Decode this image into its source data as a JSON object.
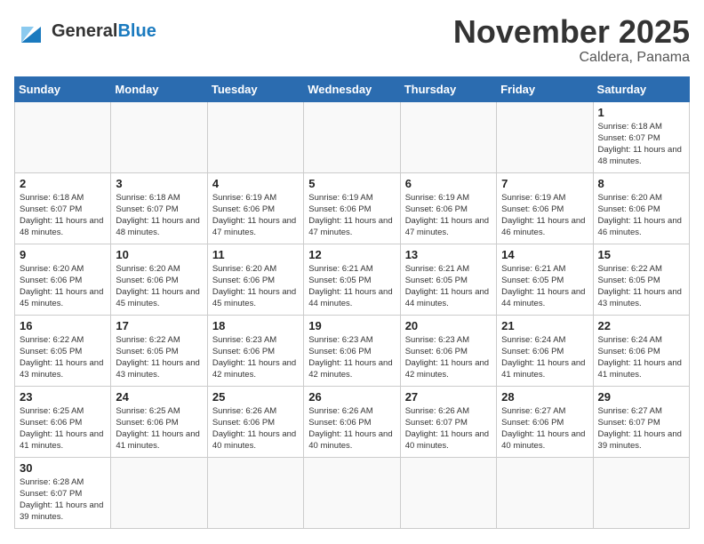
{
  "header": {
    "logo_general": "General",
    "logo_blue": "Blue",
    "month": "November 2025",
    "location": "Caldera, Panama"
  },
  "weekdays": [
    "Sunday",
    "Monday",
    "Tuesday",
    "Wednesday",
    "Thursday",
    "Friday",
    "Saturday"
  ],
  "weeks": [
    [
      {
        "day": "",
        "info": ""
      },
      {
        "day": "",
        "info": ""
      },
      {
        "day": "",
        "info": ""
      },
      {
        "day": "",
        "info": ""
      },
      {
        "day": "",
        "info": ""
      },
      {
        "day": "",
        "info": ""
      },
      {
        "day": "1",
        "info": "Sunrise: 6:18 AM\nSunset: 6:07 PM\nDaylight: 11 hours\nand 48 minutes."
      }
    ],
    [
      {
        "day": "2",
        "info": "Sunrise: 6:18 AM\nSunset: 6:07 PM\nDaylight: 11 hours\nand 48 minutes."
      },
      {
        "day": "3",
        "info": "Sunrise: 6:18 AM\nSunset: 6:07 PM\nDaylight: 11 hours\nand 48 minutes."
      },
      {
        "day": "4",
        "info": "Sunrise: 6:19 AM\nSunset: 6:06 PM\nDaylight: 11 hours\nand 47 minutes."
      },
      {
        "day": "5",
        "info": "Sunrise: 6:19 AM\nSunset: 6:06 PM\nDaylight: 11 hours\nand 47 minutes."
      },
      {
        "day": "6",
        "info": "Sunrise: 6:19 AM\nSunset: 6:06 PM\nDaylight: 11 hours\nand 47 minutes."
      },
      {
        "day": "7",
        "info": "Sunrise: 6:19 AM\nSunset: 6:06 PM\nDaylight: 11 hours\nand 46 minutes."
      },
      {
        "day": "8",
        "info": "Sunrise: 6:20 AM\nSunset: 6:06 PM\nDaylight: 11 hours\nand 46 minutes."
      }
    ],
    [
      {
        "day": "9",
        "info": "Sunrise: 6:20 AM\nSunset: 6:06 PM\nDaylight: 11 hours\nand 45 minutes."
      },
      {
        "day": "10",
        "info": "Sunrise: 6:20 AM\nSunset: 6:06 PM\nDaylight: 11 hours\nand 45 minutes."
      },
      {
        "day": "11",
        "info": "Sunrise: 6:20 AM\nSunset: 6:06 PM\nDaylight: 11 hours\nand 45 minutes."
      },
      {
        "day": "12",
        "info": "Sunrise: 6:21 AM\nSunset: 6:05 PM\nDaylight: 11 hours\nand 44 minutes."
      },
      {
        "day": "13",
        "info": "Sunrise: 6:21 AM\nSunset: 6:05 PM\nDaylight: 11 hours\nand 44 minutes."
      },
      {
        "day": "14",
        "info": "Sunrise: 6:21 AM\nSunset: 6:05 PM\nDaylight: 11 hours\nand 44 minutes."
      },
      {
        "day": "15",
        "info": "Sunrise: 6:22 AM\nSunset: 6:05 PM\nDaylight: 11 hours\nand 43 minutes."
      }
    ],
    [
      {
        "day": "16",
        "info": "Sunrise: 6:22 AM\nSunset: 6:05 PM\nDaylight: 11 hours\nand 43 minutes."
      },
      {
        "day": "17",
        "info": "Sunrise: 6:22 AM\nSunset: 6:05 PM\nDaylight: 11 hours\nand 43 minutes."
      },
      {
        "day": "18",
        "info": "Sunrise: 6:23 AM\nSunset: 6:06 PM\nDaylight: 11 hours\nand 42 minutes."
      },
      {
        "day": "19",
        "info": "Sunrise: 6:23 AM\nSunset: 6:06 PM\nDaylight: 11 hours\nand 42 minutes."
      },
      {
        "day": "20",
        "info": "Sunrise: 6:23 AM\nSunset: 6:06 PM\nDaylight: 11 hours\nand 42 minutes."
      },
      {
        "day": "21",
        "info": "Sunrise: 6:24 AM\nSunset: 6:06 PM\nDaylight: 11 hours\nand 41 minutes."
      },
      {
        "day": "22",
        "info": "Sunrise: 6:24 AM\nSunset: 6:06 PM\nDaylight: 11 hours\nand 41 minutes."
      }
    ],
    [
      {
        "day": "23",
        "info": "Sunrise: 6:25 AM\nSunset: 6:06 PM\nDaylight: 11 hours\nand 41 minutes."
      },
      {
        "day": "24",
        "info": "Sunrise: 6:25 AM\nSunset: 6:06 PM\nDaylight: 11 hours\nand 41 minutes."
      },
      {
        "day": "25",
        "info": "Sunrise: 6:26 AM\nSunset: 6:06 PM\nDaylight: 11 hours\nand 40 minutes."
      },
      {
        "day": "26",
        "info": "Sunrise: 6:26 AM\nSunset: 6:06 PM\nDaylight: 11 hours\nand 40 minutes."
      },
      {
        "day": "27",
        "info": "Sunrise: 6:26 AM\nSunset: 6:07 PM\nDaylight: 11 hours\nand 40 minutes."
      },
      {
        "day": "28",
        "info": "Sunrise: 6:27 AM\nSunset: 6:06 PM\nDaylight: 11 hours\nand 40 minutes."
      },
      {
        "day": "29",
        "info": "Sunrise: 6:27 AM\nSunset: 6:07 PM\nDaylight: 11 hours\nand 39 minutes."
      }
    ],
    [
      {
        "day": "30",
        "info": "Sunrise: 6:28 AM\nSunset: 6:07 PM\nDaylight: 11 hours\nand 39 minutes."
      },
      {
        "day": "",
        "info": ""
      },
      {
        "day": "",
        "info": ""
      },
      {
        "day": "",
        "info": ""
      },
      {
        "day": "",
        "info": ""
      },
      {
        "day": "",
        "info": ""
      },
      {
        "day": "",
        "info": ""
      }
    ]
  ]
}
